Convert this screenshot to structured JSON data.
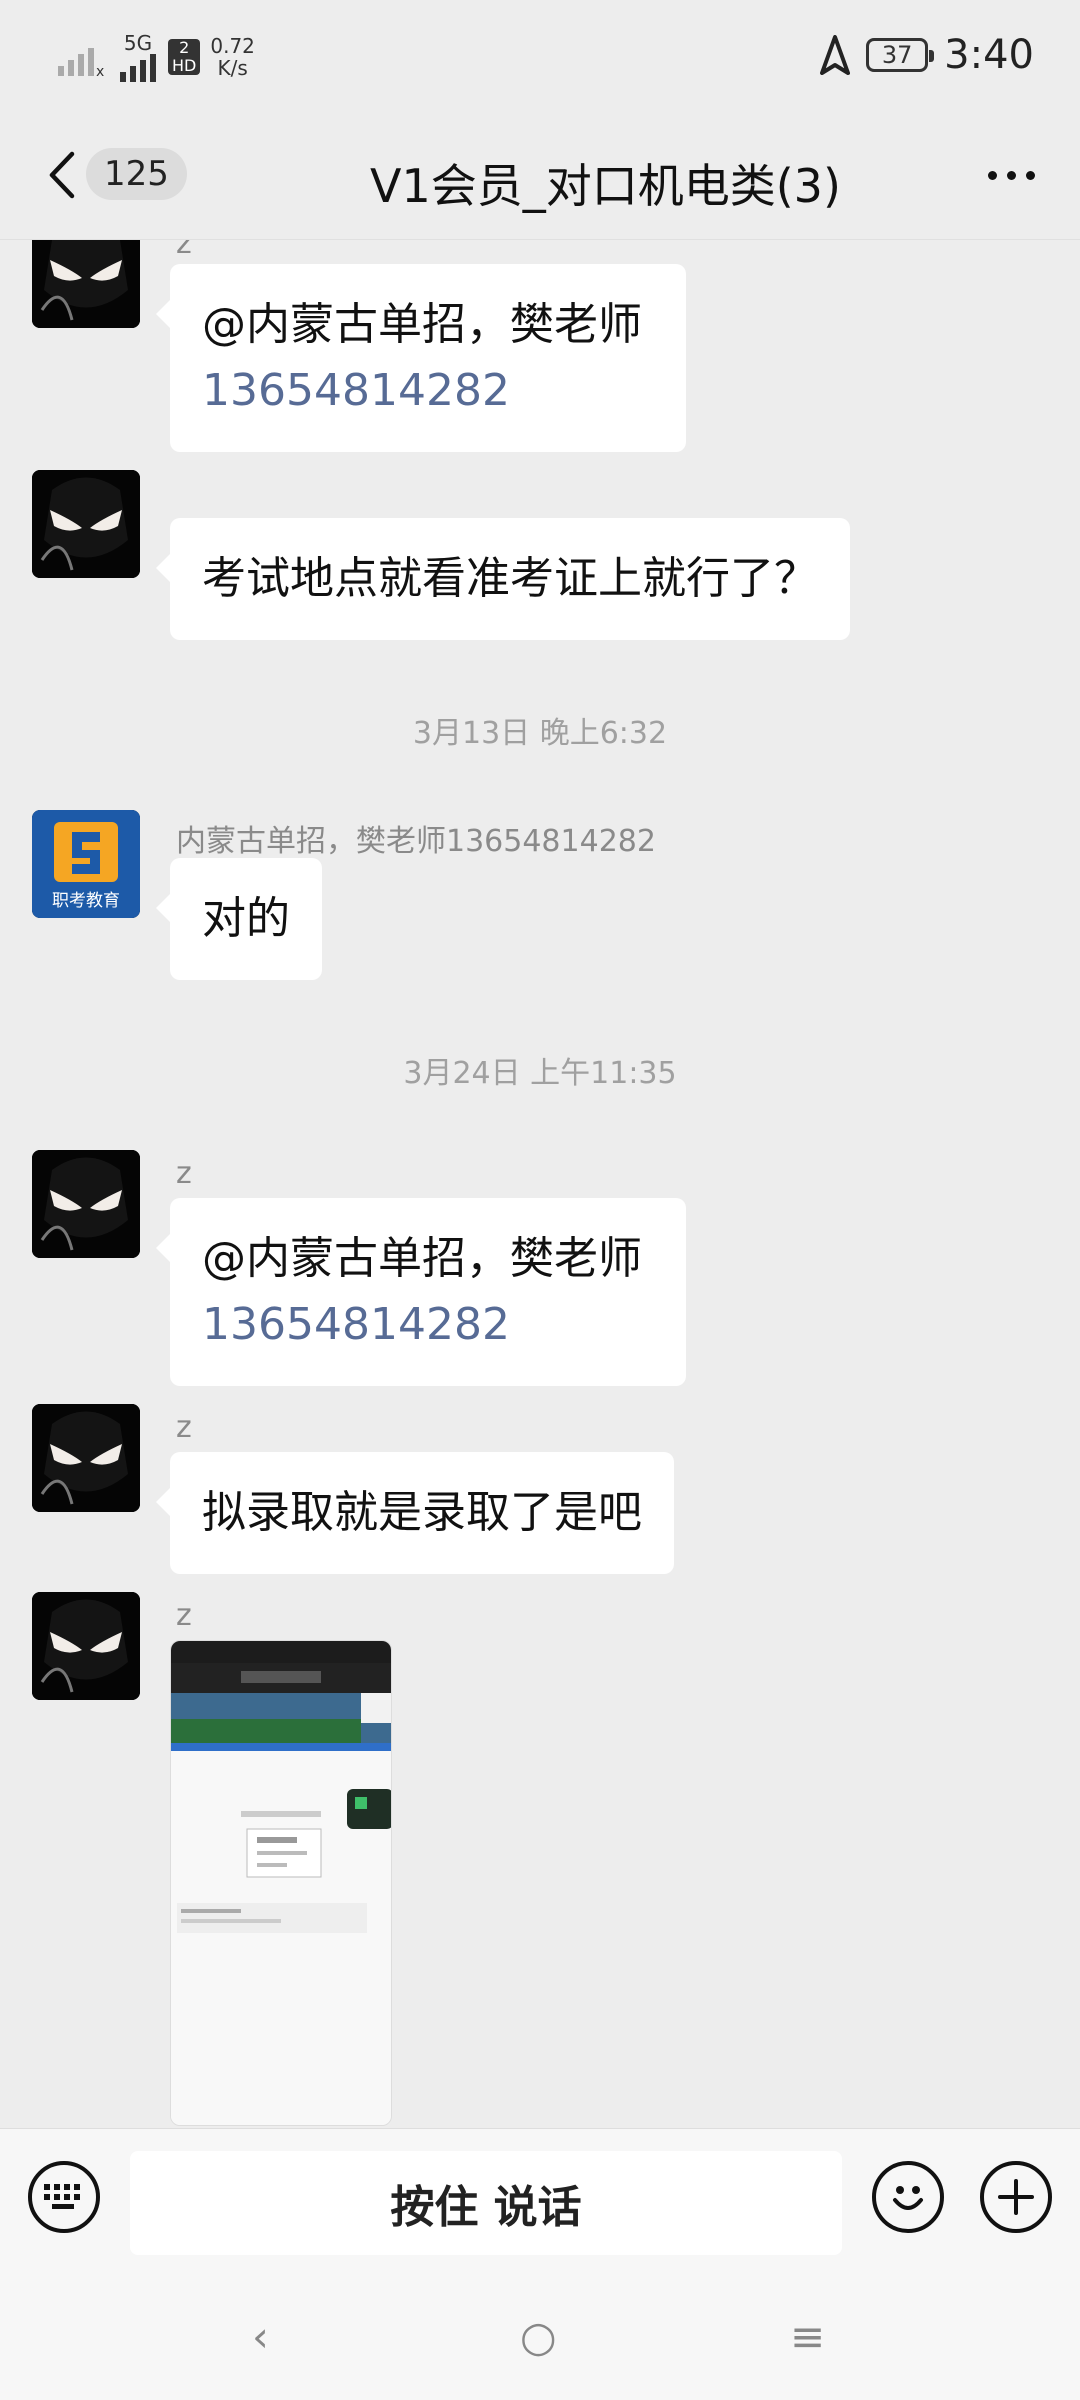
{
  "status_bar": {
    "network": "5G",
    "hd_top": "2",
    "hd_bottom": "HD",
    "speed_value": "0.72",
    "speed_unit": "K/s",
    "battery": "37",
    "time": "3:40"
  },
  "nav": {
    "unread_count": "125",
    "title": "V1会员_对口机电类(3)"
  },
  "messages": {
    "m1": {
      "sender": "z",
      "mention": "@内蒙古单招，樊老师",
      "phone": "13654814282"
    },
    "m2": {
      "text": "考试地点就看准考证上就行了？"
    },
    "t1": "3月13日 晚上6:32",
    "m3": {
      "sender": "内蒙古单招，樊老师13654814282",
      "text": "对的",
      "logo_text": "职考教育"
    },
    "t2": "3月24日 上午11:35",
    "m4": {
      "sender": "z",
      "mention": "@内蒙古单招，樊老师",
      "phone": "13654814282"
    },
    "m5": {
      "sender": "z",
      "text": "拟录取就是录取了是吧"
    },
    "m6": {
      "sender": "z"
    }
  },
  "input_bar": {
    "hold_to_talk": "按住 说话"
  },
  "system_nav": {
    "back": "‹",
    "home": "○",
    "recent": "≡"
  },
  "colors": {
    "background": "#ededed",
    "bubble": "#ffffff",
    "link": "#576b95"
  }
}
